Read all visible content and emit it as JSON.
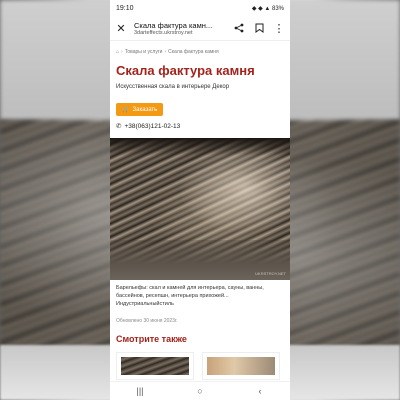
{
  "status": {
    "time": "19:10",
    "icons": "◆ ◆ ▲ 83%"
  },
  "browser": {
    "title": "Скала фактура камн...",
    "url": "3darteffects.ukrstroy.net"
  },
  "breadcrumb": [
    "Товары и услуги",
    "Скала фактура камня"
  ],
  "page": {
    "title": "Скала фактура камня",
    "subtitle": "Искусственная скала в интерьере Декор",
    "order_label": "Заказать",
    "phone": "+38(063)121-02-13",
    "photo_watermark": "UKRSTROY.NET",
    "description": "Барельефы: скал и камней для интерьера, сауны, ванны, бассейнов, ресепшн, интерьера прихожей... Индустриальныйстиль",
    "updated": "Обновлено 30 июня 2023г.",
    "see_also": "Смотрите также"
  },
  "icons": {
    "close": "close-icon",
    "share": "share-icon",
    "bookmark": "bookmark-icon",
    "menu": "more-vert-icon",
    "home": "home-icon",
    "cart": "cart-icon",
    "phone": "phone-icon"
  },
  "colors": {
    "title": "#a3231c",
    "order_button": "#f39a12"
  }
}
